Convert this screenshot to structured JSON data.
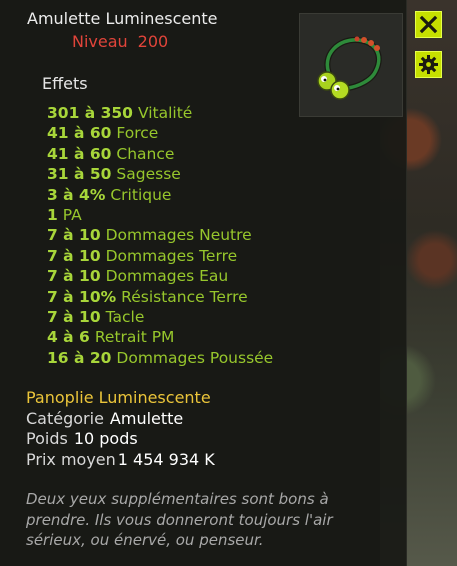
{
  "item": {
    "name": "Amulette Luminescente",
    "level_label": "Niveau",
    "level_value": "200",
    "image_icon": "amulet-icon"
  },
  "buttons": {
    "close_icon": "close-icon",
    "settings_icon": "gear-icon",
    "accent_color": "#c6e000"
  },
  "effects": {
    "heading": "Effets",
    "items": [
      {
        "value": "301 à 350",
        "label": "Vitalité"
      },
      {
        "value": "41 à 60",
        "label": "Force"
      },
      {
        "value": "41 à 60",
        "label": "Chance"
      },
      {
        "value": "31 à 50",
        "label": "Sagesse"
      },
      {
        "value": "3 à 4%",
        "label": "Critique"
      },
      {
        "value": "1",
        "label": "PA"
      },
      {
        "value": "7 à 10",
        "label": "Dommages Neutre"
      },
      {
        "value": "7 à 10",
        "label": "Dommages Terre"
      },
      {
        "value": "7 à 10",
        "label": "Dommages Eau"
      },
      {
        "value": "7 à 10%",
        "label": "Résistance Terre"
      },
      {
        "value": "7 à 10",
        "label": "Tacle"
      },
      {
        "value": "4 à 6",
        "label": "Retrait PM"
      },
      {
        "value": "16 à 20",
        "label": "Dommages Poussée"
      }
    ],
    "color": "#9fd030"
  },
  "details": {
    "set_name": "Panoplie Luminescente",
    "category_label": "Catégorie",
    "category_value": "Amulette",
    "weight_label": "Poids",
    "weight_value": "10 pods",
    "price_label": "Prix moyen",
    "price_value": "1 454 934 K"
  },
  "description": "Deux yeux supplémentaires sont bons à prendre. Ils vous donneront toujours l'air sérieux, ou énervé, ou penseur."
}
